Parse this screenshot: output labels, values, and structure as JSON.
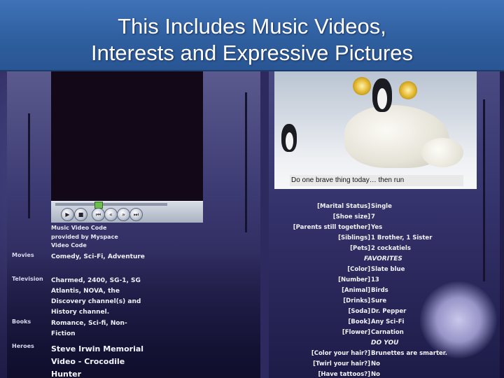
{
  "slide": {
    "title_line1": "This Includes Music Videos,",
    "title_line2": "Interests and Expressive Pictures"
  },
  "player": {
    "code_line1": "Music Video Code",
    "code_line2": "provided by Myspace",
    "code_line3": "Video Code",
    "buttons": [
      "play-icon",
      "stop-icon",
      "previous-icon",
      "rewind-icon",
      "forward-icon",
      "next-icon"
    ]
  },
  "interests": [
    {
      "label": "Movies",
      "value": "Comedy, Sci-Fi, Adventure"
    },
    {
      "label": "Television",
      "value": "Charmed, 2400, SG-1, SG Atlantis, NOVA, the Discovery channel(s) and History channel."
    },
    {
      "label": "Books",
      "value": "Romance, Sci-fi, Non-Fiction"
    },
    {
      "label": "Heroes",
      "value": "Steve Irwin Memorial Video - Crocodile Hunter"
    }
  ],
  "photo": {
    "caption": "Do  one brave thing today… then run"
  },
  "profile": [
    {
      "key": "[Marital Status]",
      "value": "Single"
    },
    {
      "key": "[Shoe size]",
      "value": "7"
    },
    {
      "key": "[Parents still together]",
      "value": "Yes"
    },
    {
      "key": "[Siblings]",
      "value": "1 Brother, 1 Sister"
    },
    {
      "key": "[Pets]",
      "value": "2 cockatiels"
    }
  ],
  "favorites_heading": "FAVORITES",
  "favorites": [
    {
      "key": "[Color]",
      "value": "Slate blue"
    },
    {
      "key": "[Number]",
      "value": "13"
    },
    {
      "key": "[Animal]",
      "value": "Birds"
    },
    {
      "key": "[Drinks]",
      "value": "Sure"
    },
    {
      "key": "[Soda]",
      "value": "Dr. Pepper"
    },
    {
      "key": "[Book]",
      "value": "Any Sci-Fi"
    },
    {
      "key": "[Flower]",
      "value": "Carnation"
    }
  ],
  "do_you_heading": "DO YOU",
  "do_you": [
    {
      "key": "[Color your hair?]",
      "value": "Brunettes are smarter."
    },
    {
      "key": "[Twirl your hair?]",
      "value": "No"
    },
    {
      "key": "[Have tattoos?]",
      "value": "No"
    }
  ]
}
